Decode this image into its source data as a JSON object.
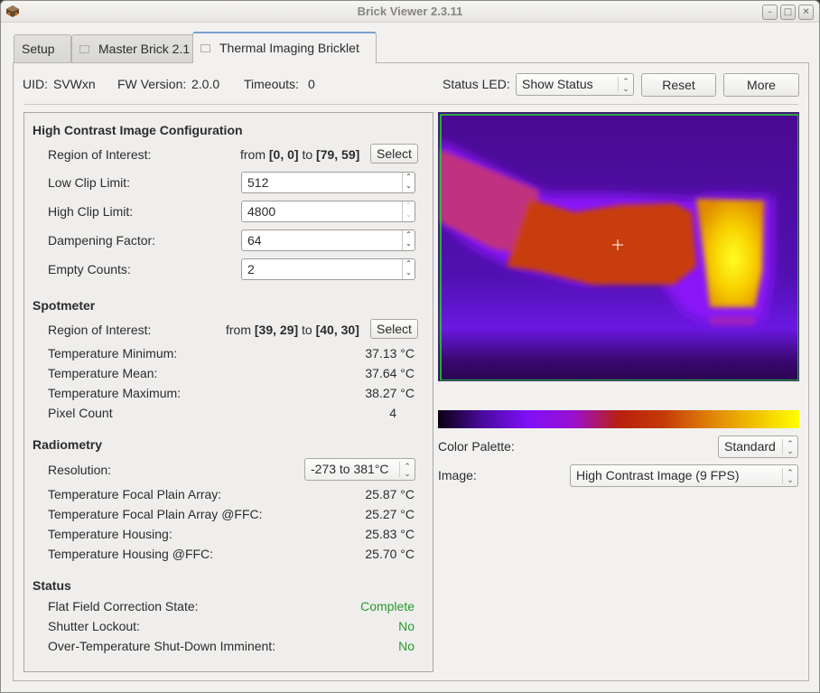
{
  "window": {
    "title": "Brick Viewer 2.3.11",
    "controls": {
      "minimize": "–",
      "maximize": "□",
      "close": "✕"
    }
  },
  "tabs": [
    {
      "label": "Setup",
      "icon": null,
      "active": false
    },
    {
      "label": "Master Brick 2.1",
      "icon": "detach-icon",
      "active": false
    },
    {
      "label": "Thermal Imaging Bricklet",
      "icon": "detach-icon",
      "active": true
    }
  ],
  "infobar": {
    "uid_label": "UID:",
    "uid_value": "SVWxn",
    "fw_label": "FW Version:",
    "fw_value": "2.0.0",
    "timeouts_label": "Timeouts:",
    "timeouts_value": "0",
    "status_led_label": "Status LED:",
    "status_led_value": "Show Status",
    "reset_label": "Reset",
    "more_label": "More"
  },
  "high_contrast": {
    "heading": "High Contrast Image Configuration",
    "roi_label": "Region of Interest:",
    "roi_from_text": "from",
    "roi_from": "[0, 0]",
    "roi_to_text": "to",
    "roi_to": "[79, 59]",
    "select_label": "Select",
    "low_clip_label": "Low Clip Limit:",
    "low_clip_value": "512",
    "high_clip_label": "High Clip Limit:",
    "high_clip_value": "4800",
    "dampening_label": "Dampening Factor:",
    "dampening_value": "64",
    "empty_counts_label": "Empty Counts:",
    "empty_counts_value": "2"
  },
  "spotmeter": {
    "heading": "Spotmeter",
    "roi_label": "Region of Interest:",
    "roi_from_text": "from",
    "roi_from": "[39, 29]",
    "roi_to_text": "to",
    "roi_to": "[40, 30]",
    "select_label": "Select",
    "rows": [
      {
        "label": "Temperature Minimum:",
        "value": "37.13  °C"
      },
      {
        "label": "Temperature Mean:",
        "value": "37.64  °C"
      },
      {
        "label": "Temperature Maximum:",
        "value": "38.27  °C"
      },
      {
        "label": "Pixel Count",
        "value": "4"
      }
    ]
  },
  "radiometry": {
    "heading": "Radiometry",
    "resolution_label": "Resolution:",
    "resolution_value": "-273 to 381°C",
    "rows": [
      {
        "label": "Temperature Focal Plain Array:",
        "value": "25.87  °C"
      },
      {
        "label": "Temperature Focal Plain Array @FFC:",
        "value": "25.27  °C"
      },
      {
        "label": "Temperature Housing:",
        "value": "25.83  °C"
      },
      {
        "label": "Temperature Housing @FFC:",
        "value": "25.70  °C"
      }
    ]
  },
  "status": {
    "heading": "Status",
    "rows": [
      {
        "label": "Flat Field Correction State:",
        "value": "Complete"
      },
      {
        "label": "Shutter Lockout:",
        "value": "No"
      },
      {
        "label": "Over-Temperature Shut-Down Imminent:",
        "value": "No"
      }
    ],
    "value_color": "#2a9a2a"
  },
  "image_panel": {
    "color_palette_label": "Color Palette:",
    "color_palette_value": "Standard",
    "image_label": "Image:",
    "image_value": "High Contrast Image (9 FPS)",
    "palette_stops": [
      "#0a0010",
      "#4b0aa0",
      "#8010f8",
      "#9a10d0",
      "#b82010",
      "#c43a08",
      "#e08008",
      "#f0c000",
      "#ffff00"
    ],
    "roi_border_color": "#20e020"
  }
}
